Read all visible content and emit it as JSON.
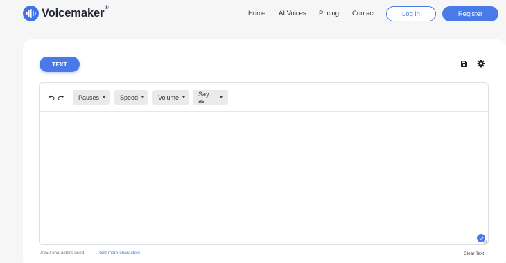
{
  "brand": {
    "name": "Voicemaker",
    "reg_mark": "®",
    "color": "#4272e6"
  },
  "nav": {
    "home": "Home",
    "ai_voices": "AI Voices",
    "pricing": "Pricing",
    "contact": "Contact"
  },
  "auth": {
    "login": "Log in",
    "register": "Register"
  },
  "tabs": {
    "text": "TEXT"
  },
  "toolbar": {
    "undo_icon": "undo-icon",
    "redo_icon": "redo-icon",
    "dropdowns": [
      "Pauses",
      "Speed",
      "Volume",
      "Say as"
    ]
  },
  "editor": {
    "content": ""
  },
  "footer": {
    "chars_used": "0/250 characters used",
    "more_chars": "→ Get more characters",
    "clear": "Clear Text"
  },
  "colors": {
    "accent": "#4a7ae8",
    "background": "#f6f6f7"
  }
}
